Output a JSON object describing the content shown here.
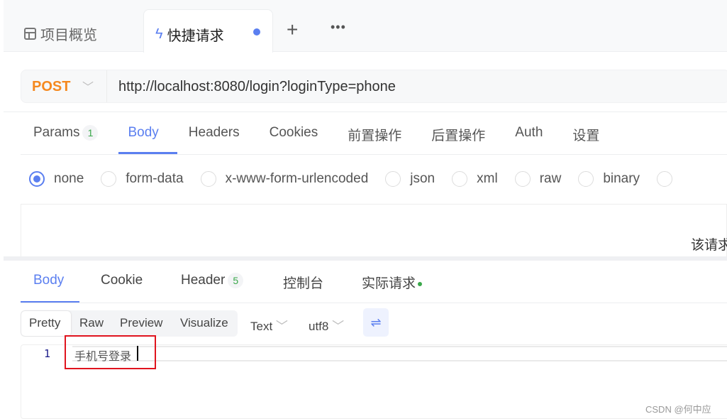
{
  "tabs": [
    {
      "label": "项目概览",
      "icon": "layout-icon"
    },
    {
      "label": "快捷请求",
      "icon": "lightning-icon",
      "modified": true
    }
  ],
  "tab_actions": {
    "add": "+",
    "more": "•••"
  },
  "request": {
    "method": "POST",
    "url": "http://localhost:8080/login?loginType=phone"
  },
  "request_tabs": [
    {
      "label": "Params",
      "badge": "1"
    },
    {
      "label": "Body",
      "active": true
    },
    {
      "label": "Headers"
    },
    {
      "label": "Cookies"
    },
    {
      "label": "前置操作"
    },
    {
      "label": "后置操作"
    },
    {
      "label": "Auth"
    },
    {
      "label": "设置"
    }
  ],
  "body_types": [
    {
      "label": "none",
      "selected": true
    },
    {
      "label": "form-data"
    },
    {
      "label": "x-www-form-urlencoded"
    },
    {
      "label": "json"
    },
    {
      "label": "xml"
    },
    {
      "label": "raw"
    },
    {
      "label": "binary"
    }
  ],
  "body_empty_text": "该请求",
  "response_tabs": [
    {
      "label": "Body",
      "active": true
    },
    {
      "label": "Cookie"
    },
    {
      "label": "Header",
      "badge": "5"
    },
    {
      "label": "控制台"
    },
    {
      "label": "实际请求"
    }
  ],
  "view_modes": [
    "Pretty",
    "Raw",
    "Preview",
    "Visualize"
  ],
  "format": "Text",
  "encoding": "utf8",
  "response_lines": [
    {
      "no": "1",
      "text": "手机号登录"
    }
  ],
  "watermark": "CSDN @何中应",
  "colors": {
    "accent": "#5b7ff0",
    "method": "#f5891f",
    "highlight": "#e0141e",
    "badge": "#3aa84a"
  }
}
